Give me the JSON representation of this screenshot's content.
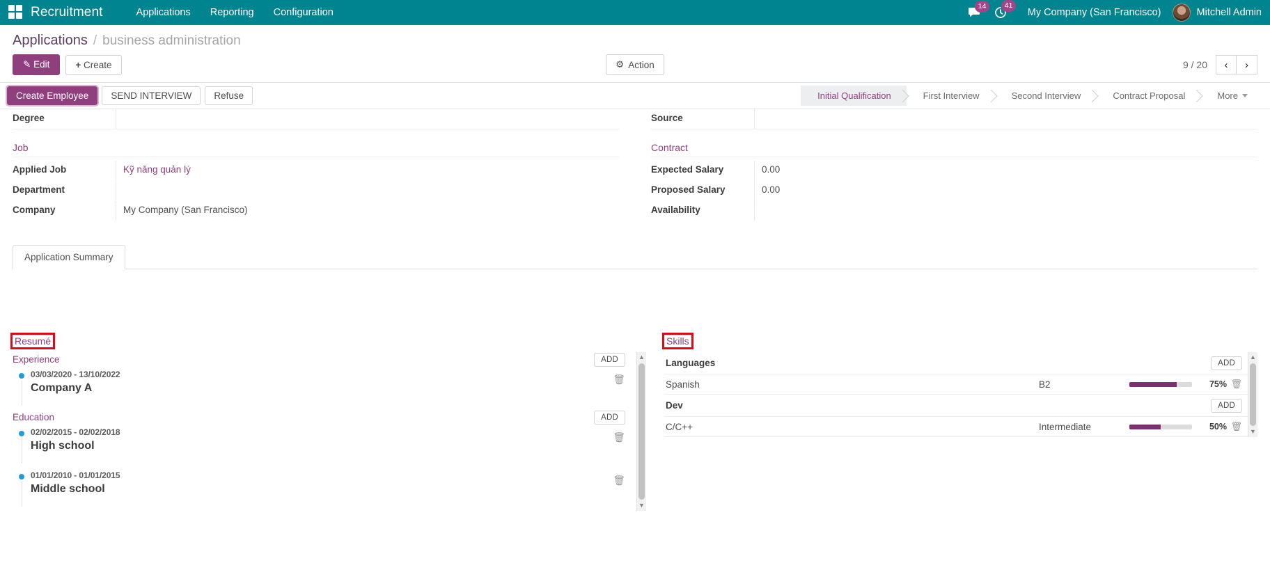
{
  "navbar": {
    "apps_icon": "apps-grid-icon",
    "brand": "Recruitment",
    "menus": [
      "Applications",
      "Reporting",
      "Configuration"
    ],
    "messages_icon": "chat-icon",
    "messages_count": "14",
    "activities_icon": "clock-icon",
    "activities_count": "41",
    "company": "My Company (San Francisco)",
    "user": "Mitchell Admin",
    "bg_color": "#00848f",
    "badge_color": "#a24689"
  },
  "control_panel": {
    "breadcrumb_root": "Applications",
    "breadcrumb_sep": "/",
    "breadcrumb_current": "business administration",
    "edit_label": "Edit",
    "create_label": "Create",
    "action_label": "Action",
    "action_icon": "gear-icon",
    "pager_value": "9 / 20",
    "prev_icon": "chevron-left-icon",
    "next_icon": "chevron-right-icon"
  },
  "statusbar": {
    "buttons": [
      {
        "label": "Create Employee",
        "highlighted": true
      },
      {
        "label": "SEND INTERVIEW",
        "highlighted": false
      },
      {
        "label": "Refuse",
        "highlighted": false
      }
    ],
    "stages": [
      {
        "label": "Initial Qualification",
        "active": true
      },
      {
        "label": "First Interview",
        "active": false
      },
      {
        "label": "Second Interview",
        "active": false
      },
      {
        "label": "Contract Proposal",
        "active": false
      },
      {
        "label": "More",
        "active": false,
        "caret": true
      }
    ]
  },
  "form": {
    "left": {
      "degree_label": "Degree",
      "degree_value": "",
      "job_group": "Job",
      "applied_job_label": "Applied Job",
      "applied_job_value": "Kỹ năng quản lý",
      "department_label": "Department",
      "department_value": "",
      "company_label": "Company",
      "company_value": "My Company (San Francisco)"
    },
    "right": {
      "source_label": "Source",
      "source_value": "",
      "contract_group": "Contract",
      "expected_salary_label": "Expected Salary",
      "expected_salary_value": "0.00",
      "proposed_salary_label": "Proposed Salary",
      "proposed_salary_value": "0.00",
      "availability_label": "Availability",
      "availability_value": ""
    }
  },
  "notebook": {
    "tabs": [
      {
        "label": "Application Summary",
        "active": true
      }
    ]
  },
  "resume": {
    "title": "Resumé",
    "annotated": true,
    "add_label": "ADD",
    "trash_icon": "trash-icon",
    "groups": [
      {
        "name": "Experience",
        "add_label": "ADD",
        "entries": [
          {
            "dates": "03/03/2020 - 13/10/2022",
            "name": "Company A"
          }
        ]
      },
      {
        "name": "Education",
        "add_label": "ADD",
        "entries": [
          {
            "dates": "02/02/2015 - 02/02/2018",
            "name": "High school"
          },
          {
            "dates": "01/01/2010 - 01/01/2015",
            "name": "Middle school"
          }
        ]
      }
    ]
  },
  "skills": {
    "title": "Skills",
    "annotated": true,
    "add_label": "ADD",
    "trash_icon": "trash-icon",
    "groups": [
      {
        "name": "Languages",
        "add_label": "ADD",
        "rows": [
          {
            "name": "Spanish",
            "level": "B2",
            "percent": "75%",
            "value": 75
          }
        ]
      },
      {
        "name": "Dev",
        "add_label": "ADD",
        "rows": [
          {
            "name": "C/C++",
            "level": "Intermediate",
            "percent": "50%",
            "value": 50
          }
        ]
      }
    ],
    "bar_color": "#7d3070"
  }
}
